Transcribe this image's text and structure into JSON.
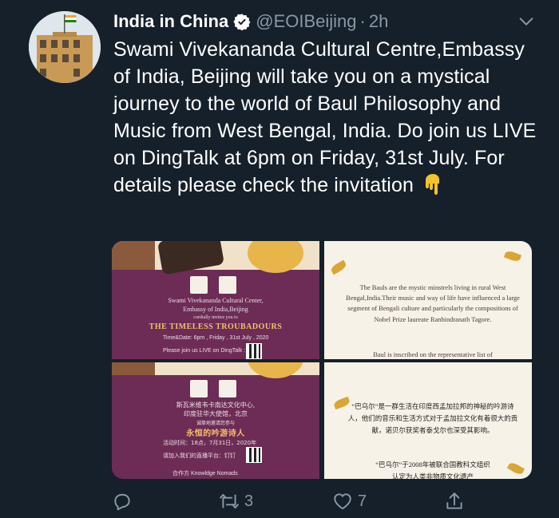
{
  "tweet": {
    "display_name": "India in China",
    "handle": "@EOIBeijing",
    "separator": "·",
    "time": "2h",
    "text": "Swami Vivekananda Cultural Centre,Embassy of India, Beijing will take you on a mystical journey to the world of Baul Philosophy and Music from West Bengal, India. Do join us LIVE on DingTalk at 6pm on Friday, 31st July. For details please check the invitation",
    "emoji": "backhand-index-pointing-down",
    "verified_icon": "verified-badge-icon",
    "menu_icon": "chevron-down-icon"
  },
  "media": {
    "invitation_en": {
      "org_line1": "Swami Vivekananda Cultural Center,",
      "org_line2": "Embassy of India,Beijing",
      "invites": "cordially invites you to",
      "title": "THE TIMELESS TROUBADOURS",
      "time_date": "Time&Date: 6pm , Friday , 31st July , 2020",
      "join": "Please join us LIVE on DingTalk :"
    },
    "description_en": {
      "text": "The Bauls are the mystic minstrels living in rural West Bengal,India.Their music and way of life have influenced a large segment of Bengali culture and particularly the compositions of Nobel Prize laureate Ranbindranath Tagore.",
      "cut_line": "Baul is inscribed on the representative list of"
    },
    "invitation_cn": {
      "org_line1": "斯瓦米维韦卡南达文化中心,",
      "org_line2": "印度驻华大使馆，北京",
      "invites": "诚挚地邀请您参与",
      "title": "永恒的吟游诗人",
      "time_date": "活动时间：18点，7月31日，2020年",
      "join": "请加入我们的直播平台：钉钉",
      "partner": "合作方 Knowldge Nomads"
    },
    "description_cn": {
      "text": "“巴乌尔”是一群生活在印度西孟加拉邦的神秘的吟游诗人，他们的音乐和生活方式对于孟加拉文化有着很大的贡献，诺贝尔获奖者泰戈尔也深受其影响。",
      "line2": "“巴乌尔”于2008年被联合国教科文组织",
      "cut_line": "认定为人类非物质文化遗产"
    }
  },
  "actions": {
    "reply": {
      "icon": "reply-icon",
      "count": ""
    },
    "retweet": {
      "icon": "retweet-icon",
      "count": "3"
    },
    "like": {
      "icon": "heart-icon",
      "count": "7"
    },
    "share": {
      "icon": "share-icon",
      "count": ""
    }
  },
  "colors": {
    "background": "#15202b",
    "secondary_text": "#8899a6",
    "verified_blue": "#ffffff",
    "invitation_purple": "#6d2c55",
    "invitation_gold": "#f4c06a"
  }
}
